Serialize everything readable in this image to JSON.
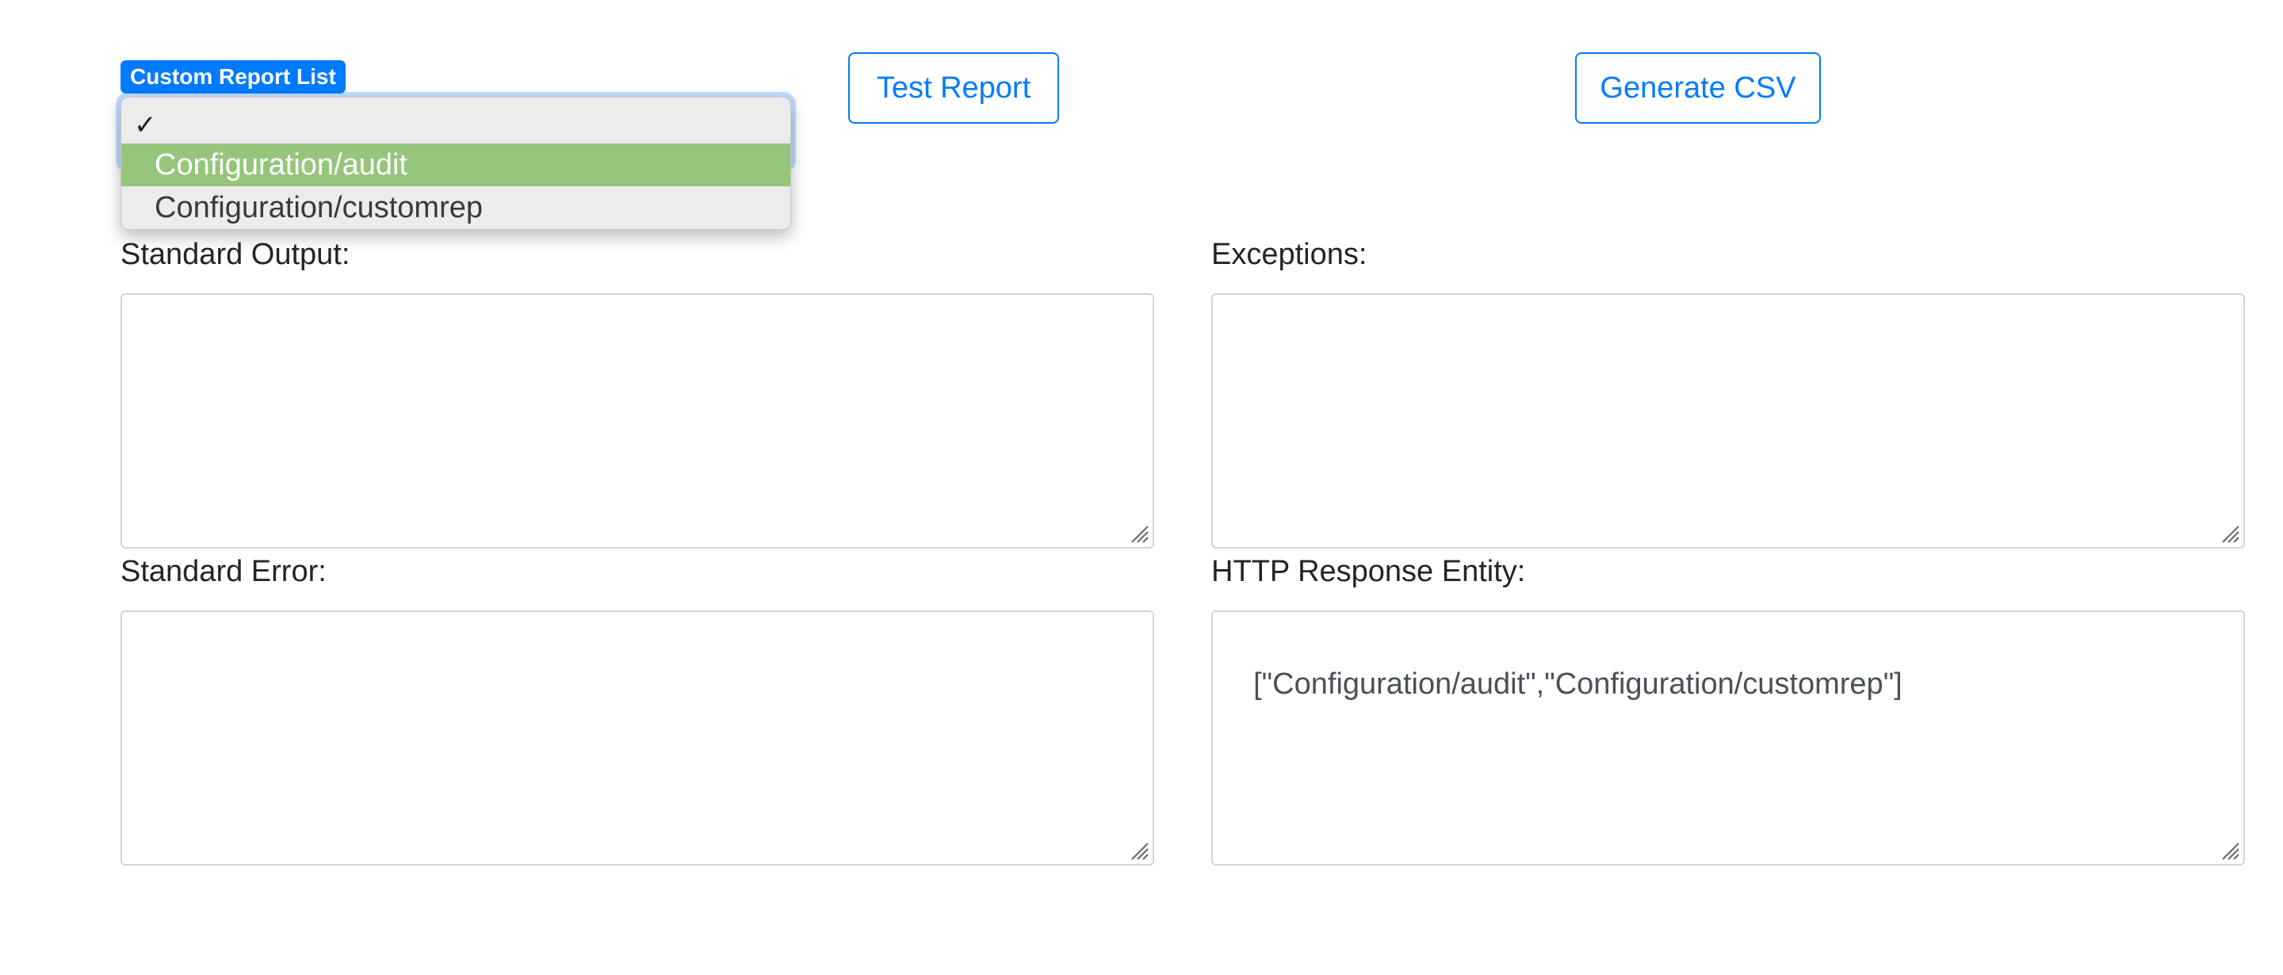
{
  "report_list": {
    "label": "Custom Report List",
    "check_glyph": "✓",
    "options": [
      "",
      "Configuration/audit",
      "Configuration/customrep"
    ],
    "highlighted_option": "Configuration/audit"
  },
  "buttons": {
    "test_report": "Test Report",
    "generate_csv": "Generate CSV"
  },
  "fields": {
    "standard_output": {
      "label": "Standard Output:",
      "value": ""
    },
    "exceptions": {
      "label": "Exceptions:",
      "value": ""
    },
    "standard_error": {
      "label": "Standard Error:",
      "value": ""
    },
    "http_response_entity": {
      "label": "HTTP Response Entity:",
      "value": "[\"Configuration/audit\",\"Configuration/customrep\"]"
    }
  },
  "colors": {
    "primary": "#007bff",
    "highlight": "#96c57c",
    "border": "#ced4da"
  }
}
